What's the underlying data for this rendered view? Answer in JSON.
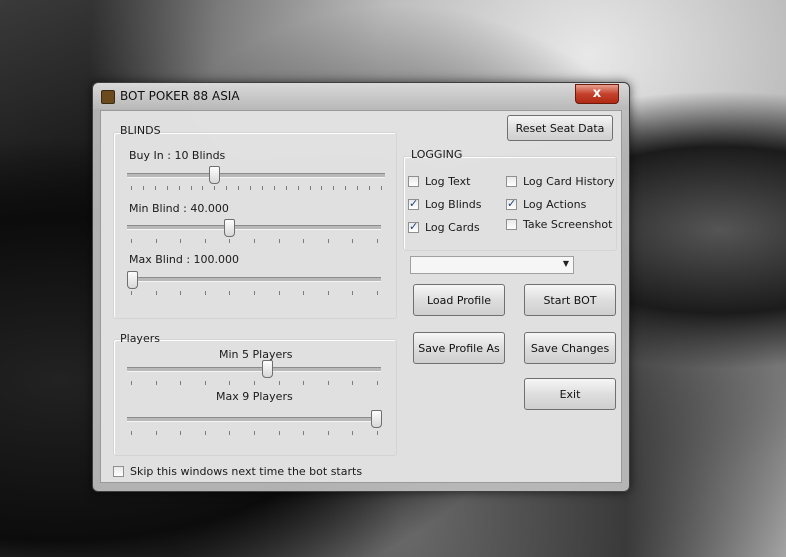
{
  "window": {
    "title": "BOT POKER 88 ASIA",
    "close_glyph": "x"
  },
  "blinds": {
    "group_label": "BLINDS",
    "sliders": [
      {
        "label": "Buy In :  10 Blinds",
        "level": 0.33
      },
      {
        "label": "Min Blind : 40.000",
        "level": 0.4
      },
      {
        "label": "Max Blind : 100.000",
        "level": 0.0
      }
    ]
  },
  "players": {
    "group_label": "Players",
    "sliders": [
      {
        "label": "Min 5 Players",
        "level": 0.55
      },
      {
        "label": "Max 9 Players",
        "level": 1.0
      }
    ]
  },
  "logging": {
    "group_label": "LOGGING",
    "options": [
      {
        "label": "Log Text",
        "checked": false
      },
      {
        "label": "Log Blinds",
        "checked": true
      },
      {
        "label": "Log Cards",
        "checked": true
      },
      {
        "label": "Log Card History",
        "checked": false
      },
      {
        "label": "Log Actions",
        "checked": true
      },
      {
        "label": "Take Screenshot",
        "checked": false
      }
    ]
  },
  "profile_select": {
    "value": ""
  },
  "buttons": {
    "reset_seat_data": "Reset Seat Data",
    "load_profile": "Load Profile",
    "start_bot": "Start BOT",
    "save_profile_as": "Save Profile As",
    "save_changes": "Save Changes",
    "exit": "Exit"
  },
  "skip": {
    "label": "Skip this windows next time the bot starts",
    "checked": false
  },
  "icons": {
    "app": "app-logo-icon",
    "close": "close-icon",
    "dropdown": "chevron-down-icon"
  }
}
